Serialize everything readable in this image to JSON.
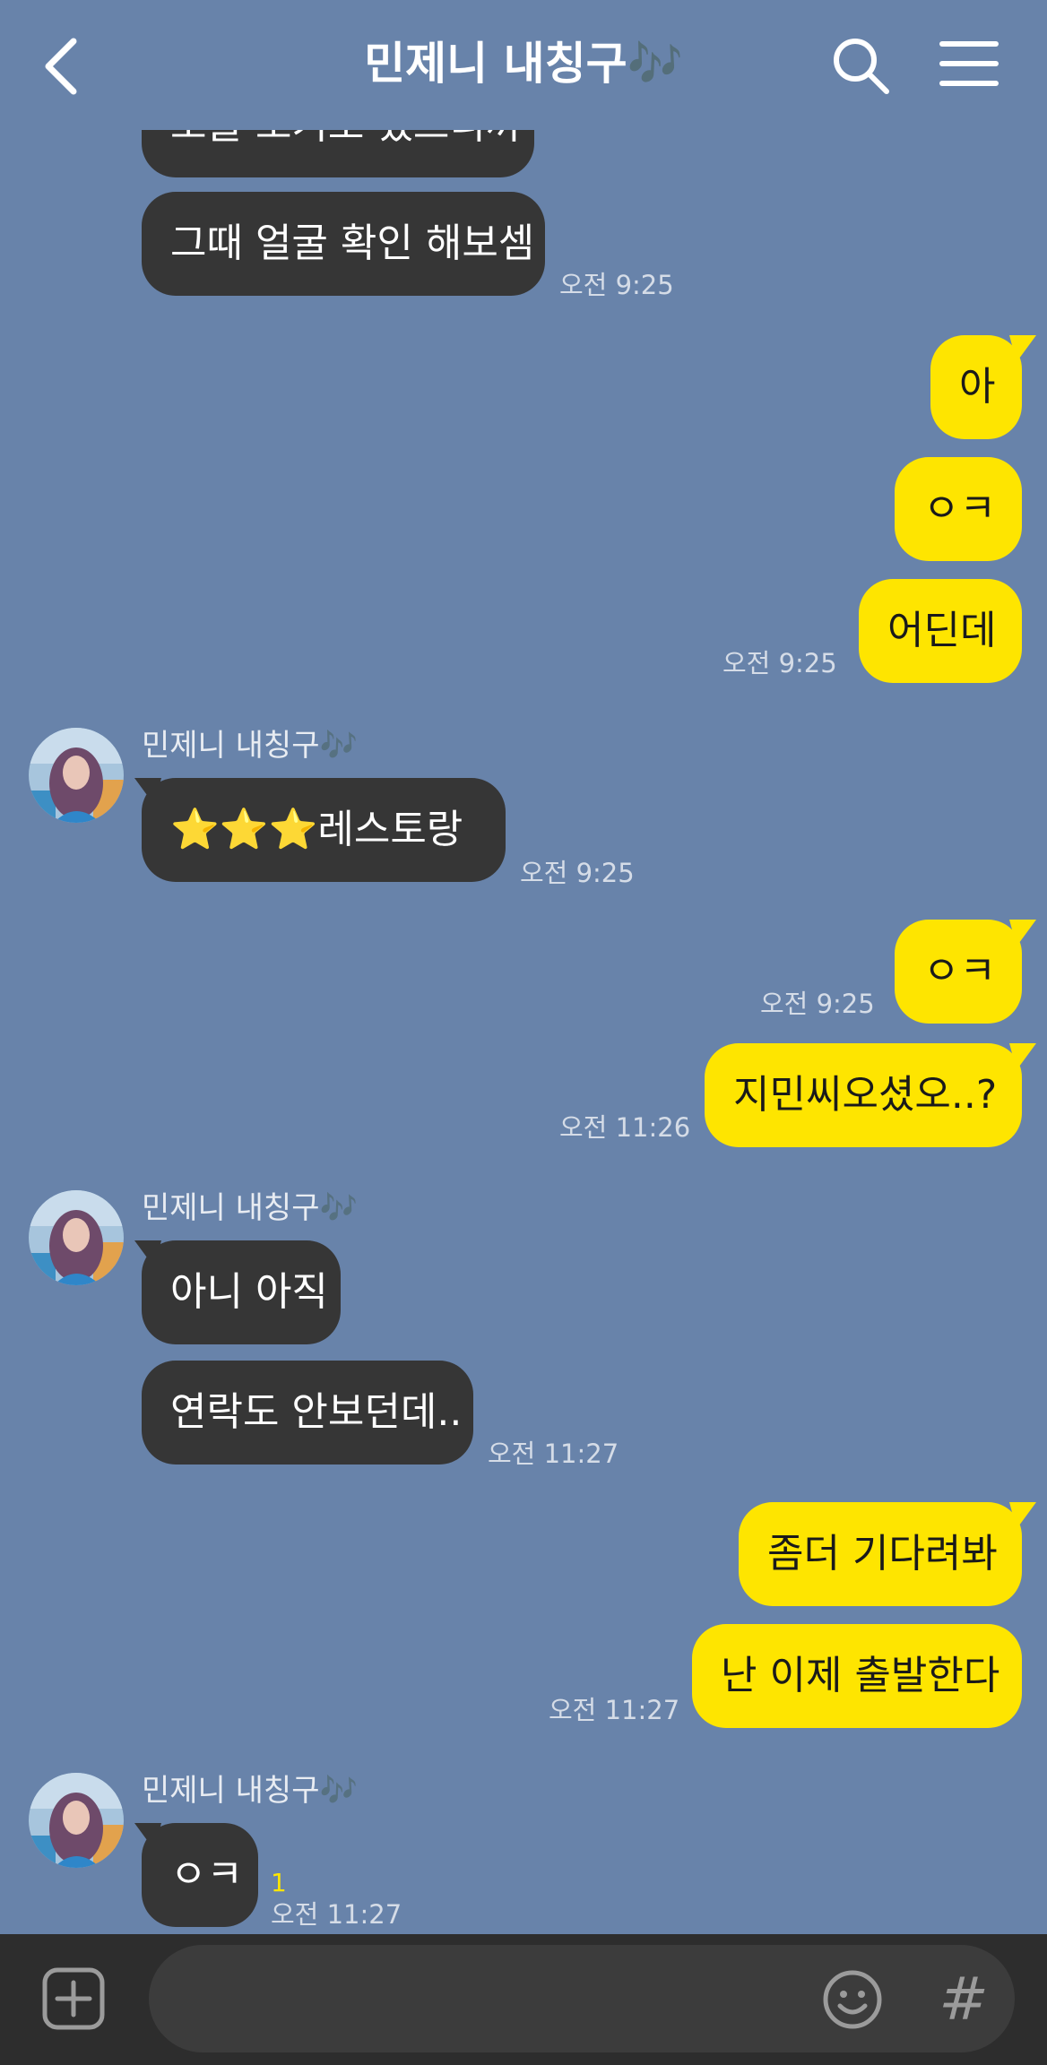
{
  "header": {
    "title": "민제니 내칭구🎶"
  },
  "friend": {
    "name": "민제니 내칭구🎶"
  },
  "messages": {
    "m1": {
      "text": "오늘 보기로 했으니까"
    },
    "m2": {
      "text": "그때 얼굴 확인 해보셈",
      "time": "오전 9:25"
    },
    "m3": {
      "text": "아"
    },
    "m4": {
      "text": "ㅇㅋ"
    },
    "m5": {
      "text": "어딘데",
      "time": "오전 9:25"
    },
    "m6": {
      "text": "⭐⭐⭐레스토랑",
      "time": "오전 9:25"
    },
    "m7": {
      "text": "ㅇㅋ",
      "time": "오전 9:25"
    },
    "m8": {
      "text": "지민씨오셨오..?",
      "time": "오전 11:26"
    },
    "m9": {
      "text": "아니 아직"
    },
    "m10": {
      "text": "연락도 안보던데..",
      "time": "오전 11:27"
    },
    "m11": {
      "text": "좀더 기다려봐"
    },
    "m12": {
      "text": "난 이제 출발한다",
      "time": "오전 11:27"
    },
    "m13": {
      "text": "ㅇㅋ",
      "time": "오전 11:27",
      "unread": "1"
    }
  },
  "input": {
    "placeholder": ""
  },
  "icons": {
    "back": "chevron-left-icon",
    "search": "search-icon",
    "menu": "hamburger-menu-icon",
    "plus": "plus-square-icon",
    "emoji": "smiley-icon",
    "hash": "hash-icon"
  },
  "colors": {
    "background": "#6883aa",
    "incoming_bubble": "#363636",
    "outgoing_bubble": "#fee500",
    "input_bar": "#2d2d2d",
    "unread_count": "#fee500"
  }
}
